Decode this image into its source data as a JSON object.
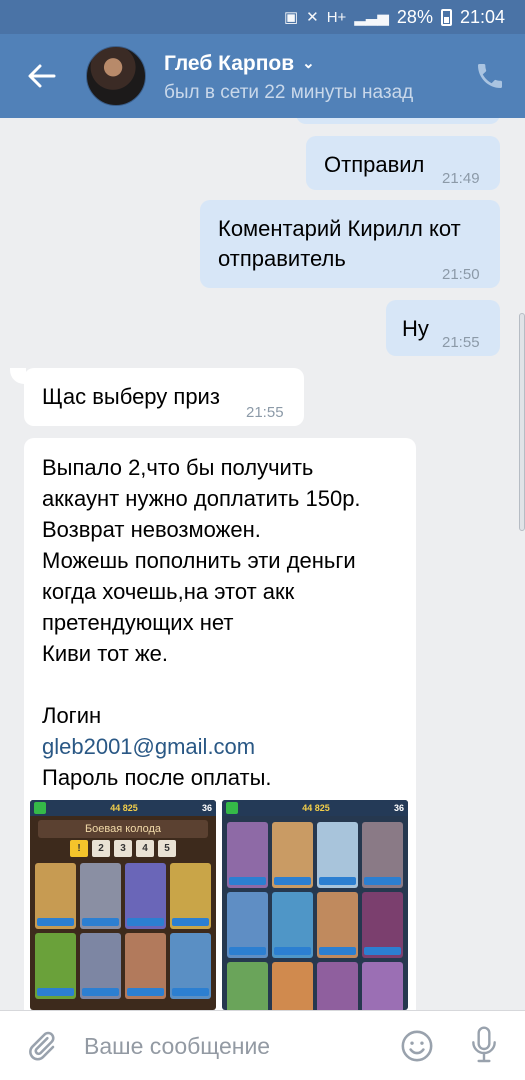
{
  "status_bar": {
    "battery_percent": "28%",
    "time": "21:04",
    "network": "H+"
  },
  "header": {
    "contact_name": "Глеб Карпов",
    "last_seen": "был в сети 22 минуты назад"
  },
  "messages": [
    {
      "direction": "out",
      "text": "Отправил",
      "time": "21:49"
    },
    {
      "direction": "out",
      "lines": [
        "Коментарий Кирилл кот",
        "отправитель"
      ],
      "time": "21:50"
    },
    {
      "direction": "out",
      "text": "Ну",
      "time": "21:55"
    },
    {
      "direction": "in",
      "text": "Щас выберу приз",
      "time": "21:55"
    },
    {
      "direction": "in",
      "lines": [
        "Выпало 2,что бы получить",
        "аккаунт нужно доплатить 150р.",
        "Возврат  невозможен.",
        "Можешь пополнить эти деньги",
        "когда хочешь,на этот акк",
        "претендующих нет",
        "Киви тот же."
      ],
      "login_label": "Логин",
      "email": "gleb2001@gmail.com",
      "password_note": "Пароль после оплаты."
    }
  ],
  "game_screens": [
    {
      "gold": "44 825",
      "trophies": "36",
      "title": "Боевая колода",
      "tabs": [
        "1",
        "2",
        "3",
        "4",
        "5"
      ]
    },
    {
      "gold": "44 825",
      "trophies": "36"
    }
  ],
  "input": {
    "placeholder": "Ваше сообщение"
  },
  "colors": {
    "header": "#5181b8",
    "outgoing_bubble": "#d7e6f7",
    "link": "#2a5885"
  }
}
